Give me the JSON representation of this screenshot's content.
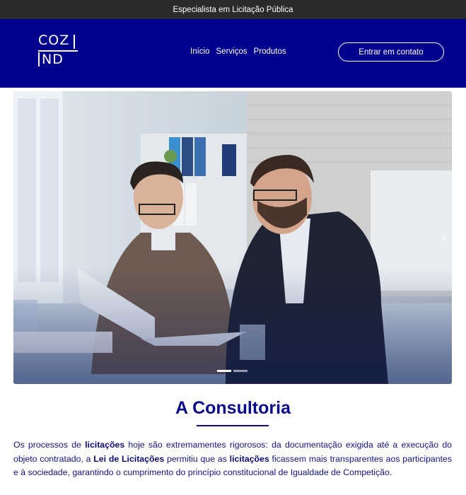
{
  "topbar": {
    "text": "Especialista em Licitação Pública"
  },
  "header": {
    "logo": {
      "line1": "COZ",
      "line2": "ND"
    },
    "nav": [
      {
        "label": "Início"
      },
      {
        "label": "Serviços"
      },
      {
        "label": "Produtos"
      }
    ],
    "cta_label": "Entrar em contato"
  },
  "hero": {
    "next_icon": "chevron-right-icon",
    "slides": 2,
    "active_slide": 1
  },
  "section": {
    "title": "A Consultoria",
    "paragraph": [
      {
        "text": "Os processos de ",
        "bold": false
      },
      {
        "text": "licitações",
        "bold": true
      },
      {
        "text": " hoje são extremamentes rigorosos: da documentação exigida até a execução do objeto contratado, a ",
        "bold": false
      },
      {
        "text": "Lei de Licitações",
        "bold": true
      },
      {
        "text": " permitiu que as ",
        "bold": false
      },
      {
        "text": "licitações",
        "bold": true
      },
      {
        "text": " ficassem mais transparentes aos participantes e à sociedade, garantindo o cumprimento do princípio constitucional de Igualdade de Competição.",
        "bold": false
      }
    ]
  },
  "colors": {
    "topbar": "#2b2b2b",
    "navbar": "#00008f",
    "accent": "#0a0a8c"
  }
}
